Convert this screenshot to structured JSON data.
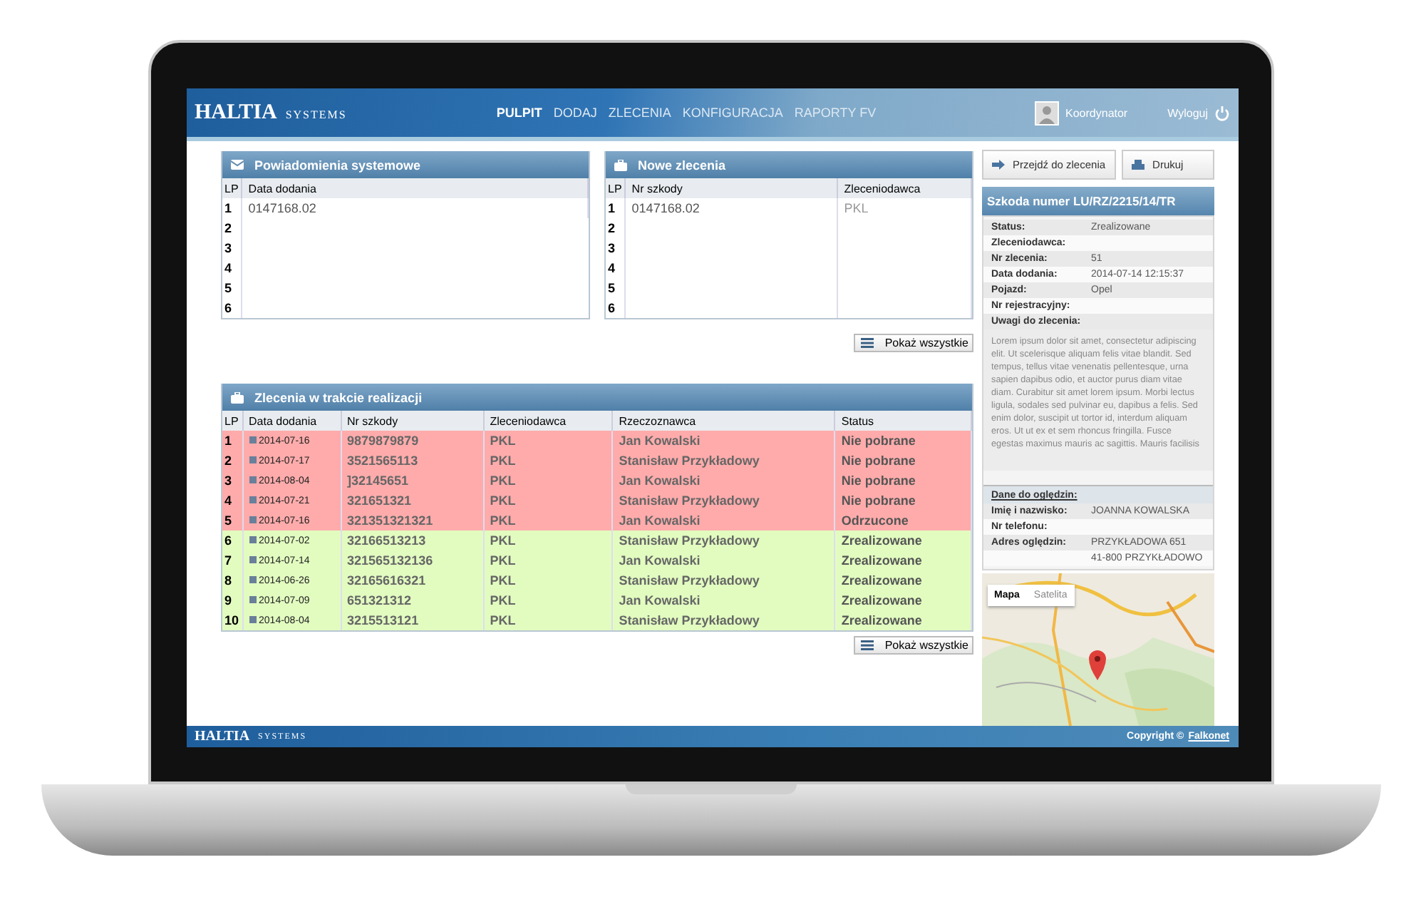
{
  "brand": {
    "name": "HALTIA",
    "suffix": "SYSTEMS"
  },
  "nav": [
    {
      "label": "PULPIT",
      "selected": true
    },
    {
      "label": "DODAJ",
      "selected": false
    },
    {
      "label": "ZLECENIA",
      "selected": false
    },
    {
      "label": "KONFIGURACJA",
      "selected": false
    },
    {
      "label": "RAPORTY FV",
      "selected": false
    }
  ],
  "user": {
    "name": "Koordynator",
    "logout": "Wyloguj"
  },
  "notifications": {
    "title": "Powiadomienia systemowe",
    "columns": [
      "LP",
      "Data dodania"
    ],
    "rows": [
      [
        "1",
        "0147168.02"
      ],
      [
        "2"
      ],
      [
        "3"
      ],
      [
        "4"
      ],
      [
        "5"
      ],
      [
        "6"
      ]
    ]
  },
  "new_orders": {
    "title": "Nowe zlecenia",
    "columns": [
      "LP",
      "Nr szkody",
      "Zleceniodawca"
    ],
    "rows": [
      [
        "1",
        "0147168.02",
        "PKL"
      ],
      [
        "2",
        null,
        null
      ],
      [
        "3",
        null,
        null
      ],
      [
        "4",
        null,
        null
      ],
      [
        "5",
        null,
        null
      ],
      [
        "6",
        null,
        null
      ]
    ]
  },
  "show_all_top": "Pokaż wszystkie",
  "in_progress": {
    "title": "Zlecenia w trakcie realizacji",
    "columns": [
      "LP",
      "Data dodania",
      "Nr szkody",
      "Zleceniodawca",
      "Rzeczoznawca",
      "Status"
    ],
    "rows": [
      {
        "color": "#ffabab",
        "cells": [
          "1",
          "2014-07-16",
          "9879879879",
          "PKL",
          "Jan Kowalski",
          "Nie pobrane"
        ]
      },
      {
        "color": "#ffabab",
        "cells": [
          "2",
          "2014-07-17",
          "3521565113",
          "PKL",
          "Stanisław Przykładowy",
          "Nie pobrane"
        ]
      },
      {
        "color": "#ffabab",
        "cells": [
          "3",
          "2014-08-04",
          "]32145651",
          "PKL",
          "Jan Kowalski",
          "Nie pobrane"
        ]
      },
      {
        "color": "#ffabab",
        "cells": [
          "4",
          "2014-07-21",
          "321651321",
          "PKL",
          "Stanisław Przykładowy",
          "Nie pobrane"
        ]
      },
      {
        "color": "#ffabab",
        "cells": [
          "5",
          "2014-07-16",
          "321351321321",
          "PKL",
          "Jan Kowalski",
          "Odrzucone"
        ]
      },
      {
        "color": "#e2fcc0",
        "cells": [
          "6",
          "2014-07-02",
          "32166513213",
          "PKL",
          "Stanisław Przykładowy",
          "Zrealizowane"
        ]
      },
      {
        "color": "#e2fcc0",
        "cells": [
          "7",
          "2014-07-14",
          "321565132136",
          "PKL",
          "Jan Kowalski",
          "Zrealizowane"
        ]
      },
      {
        "color": "#e2fcc0",
        "cells": [
          "8",
          "2014-06-26",
          "32165616321",
          "PKL",
          "Stanisław Przykładowy",
          "Zrealizowane"
        ]
      },
      {
        "color": "#e2fcc0",
        "cells": [
          "9",
          "2014-07-09",
          "651321312",
          "PKL",
          "Jan Kowalski",
          "Zrealizowane"
        ]
      },
      {
        "color": "#e2fcc0",
        "cells": [
          "10",
          "2014-08-04",
          "3215513121",
          "PKL",
          "Stanisław Przykładowy",
          "Zrealizowane"
        ]
      }
    ]
  },
  "show_all_bottom": "Pokaż wszystkie",
  "actions": [
    "Przejdź do zlecenia",
    "Drukuj"
  ],
  "detail": {
    "title": "Szkoda numer LU/RZ/2215/14/TR",
    "fields": [
      {
        "label": "Status:",
        "value": "Zrealizowane"
      },
      {
        "label": "Zleceniodawca:"
      },
      {
        "label": "Nr zlecenia:",
        "value": "51"
      },
      {
        "label": "Data dodania:",
        "value": "2014-07-14 12:15:37"
      },
      {
        "label": "Pojazd:",
        "value": "Opel"
      },
      {
        "label": "Nr rejestracyjny:"
      },
      {
        "label": "Uwagi do zlecenia:"
      }
    ],
    "notes": "Lorem ipsum dolor sit amet, consectetur adipiscing elit. Ut scelerisque aliquam felis vitae blandit. Sed tempus, tellus vitae venenatis pellentesque, urna sapien dapibus odio, et auctor purus diam vitae diam. Curabitur sit amet lorem ipsum. Morbi lectus ligula, sodales sed pulvinar eu, dapibus a felis. Sed enim dolor, suscipit ut tortor id, interdum aliquam eros. Ut ut ex et sem rhoncus fringilla. Fusce egestas maximus mauris ac sagittis. Mauris facilisis",
    "inspection_title": "Dane do oględzin:",
    "inspection": [
      {
        "label": "Imię i nazwisko:",
        "value": "JOANNA KOWALSKA"
      },
      {
        "label": "Nr telefonu:"
      },
      {
        "label": "Adres oględzin:",
        "value": "PRZYKŁADOWA 651"
      },
      {
        "value": "41-800  PRZYKŁADOWO"
      }
    ]
  },
  "map_tabs": [
    {
      "label": "Mapa",
      "selected": true
    },
    {
      "label": "Satelita",
      "selected": false
    }
  ],
  "footer": {
    "brand_name": "HALTIA",
    "brand_suffix": "SYSTEMS",
    "copyright": "Copyright ©",
    "link": "Falkonet"
  }
}
